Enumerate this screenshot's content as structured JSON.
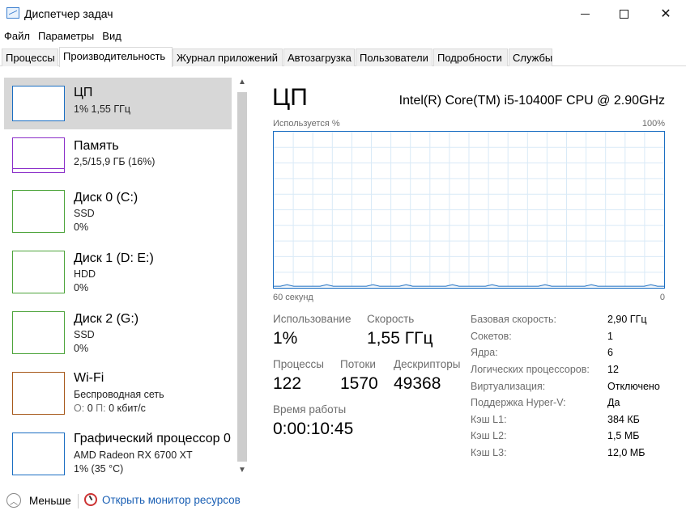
{
  "window": {
    "title": "Диспетчер задач",
    "minimize_glyph": "—",
    "maximize_glyph": "☐",
    "close_glyph": "✕"
  },
  "menu": [
    "Файл",
    "Параметры",
    "Вид"
  ],
  "tabs": [
    {
      "label": "Процессы",
      "active": false
    },
    {
      "label": "Производительность",
      "active": true
    },
    {
      "label": "Журнал приложений",
      "active": false
    },
    {
      "label": "Автозагрузка",
      "active": false
    },
    {
      "label": "Пользователи",
      "active": false
    },
    {
      "label": "Подробности",
      "active": false
    },
    {
      "label": "Службы",
      "active": false
    }
  ],
  "sidebar": {
    "items": [
      {
        "title": "ЦП",
        "sub1": "1% 1,55 ГГц",
        "sub2": "",
        "color": "#1b6ec2",
        "active": true
      },
      {
        "title": "Память",
        "sub1": "2,5/15,9 ГБ (16%)",
        "sub2": "",
        "color": "#8b2fc9",
        "active": false
      },
      {
        "title": "Диск 0 (C:)",
        "sub1": "SSD",
        "sub2": "0%",
        "color": "#4da43b",
        "active": false
      },
      {
        "title": "Диск 1 (D: E:)",
        "sub1": "HDD",
        "sub2": "0%",
        "color": "#4da43b",
        "active": false
      },
      {
        "title": "Диск 2 (G:)",
        "sub1": "SSD",
        "sub2": "0%",
        "color": "#4da43b",
        "active": false
      },
      {
        "title": "Wi-Fi",
        "sub1": "Беспроводная сеть",
        "sub2_label_o": "О:",
        "sub2_val_o": "0",
        "sub2_label_p": "П:",
        "sub2_val_p": "0 кбит/с",
        "color": "#a7591b",
        "active": false
      },
      {
        "title": "Графический процессор 0",
        "sub1": "AMD Radeon RX 6700 XT",
        "sub2": "1%  (35 °C)",
        "color": "#1b6ec2",
        "active": false
      }
    ]
  },
  "main": {
    "title": "ЦП",
    "cpu_name": "Intel(R) Core(TM) i5-10400F CPU @ 2.90GHz",
    "graph_top_left": "Используется %",
    "graph_top_right": "100%",
    "graph_bottom_left": "60 секунд",
    "graph_bottom_right": "0",
    "graph_color": "#1b6ec2",
    "usage_history_percent": [
      1,
      1,
      2,
      1,
      1,
      1,
      1,
      1,
      2,
      1,
      1,
      1,
      1,
      1,
      1,
      2,
      1,
      1,
      1,
      1,
      2,
      1,
      1,
      1,
      1,
      1,
      1,
      2,
      1,
      1,
      1,
      1,
      1,
      2,
      1,
      1,
      1,
      1,
      1,
      1,
      1,
      2,
      1,
      1,
      1,
      1,
      1,
      1,
      2,
      1,
      1,
      1,
      1,
      1,
      1,
      1,
      1,
      2,
      1,
      1
    ],
    "stats": {
      "usage_label": "Использование",
      "usage_value": "1%",
      "speed_label": "Скорость",
      "speed_value": "1,55 ГГц",
      "processes_label": "Процессы",
      "processes_value": "122",
      "threads_label": "Потоки",
      "threads_value": "1570",
      "handles_label": "Дескрипторы",
      "handles_value": "49368",
      "uptime_label": "Время работы",
      "uptime_value": "0:00:10:45"
    },
    "specs": [
      {
        "label": "Базовая скорость:",
        "value": "2,90 ГГц"
      },
      {
        "label": "Сокетов:",
        "value": "1"
      },
      {
        "label": "Ядра:",
        "value": "6"
      },
      {
        "label": "Логических процессоров:",
        "value": "12"
      },
      {
        "label": "Виртуализация:",
        "value": "Отключено"
      },
      {
        "label": "Поддержка Hyper-V:",
        "value": "Да"
      },
      {
        "label": "Кэш L1:",
        "value": "384 КБ"
      },
      {
        "label": "Кэш L2:",
        "value": "1,5 МБ"
      },
      {
        "label": "Кэш L3:",
        "value": "12,0 МБ"
      }
    ]
  },
  "footer": {
    "less_label": "Меньше",
    "monitor_link": "Открыть монитор ресурсов"
  }
}
